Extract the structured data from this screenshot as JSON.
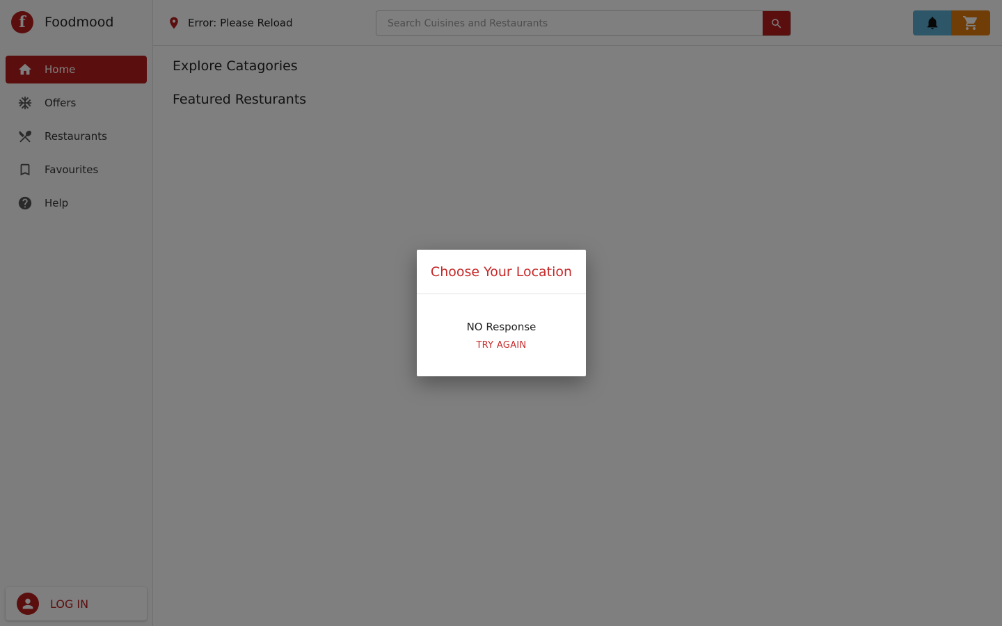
{
  "brand": {
    "name": "Foodmood",
    "logo_letter": "f"
  },
  "sidebar": {
    "items": [
      {
        "label": "Home",
        "icon": "home-icon",
        "active": true
      },
      {
        "label": "Offers",
        "icon": "snowflake-icon",
        "active": false
      },
      {
        "label": "Restaurants",
        "icon": "fork-knife-icon",
        "active": false
      },
      {
        "label": "Favourites",
        "icon": "bookmark-icon",
        "active": false
      },
      {
        "label": "Help",
        "icon": "help-icon",
        "active": false
      }
    ],
    "login_label": "LOG IN"
  },
  "header": {
    "location_text": "Error: Please Reload",
    "search_placeholder": "Search Cuisines and Restaurants"
  },
  "main": {
    "sections": [
      "Explore Catagories",
      "Featured Resturants"
    ]
  },
  "dialog": {
    "title": "Choose Your Location",
    "message": "NO Response",
    "action_label": "TRY AGAIN"
  },
  "colors": {
    "brand": "#b71c1c",
    "notification_button": "#5aaed0",
    "cart_button": "#e07b0c",
    "dialog_accent": "#c62828"
  }
}
